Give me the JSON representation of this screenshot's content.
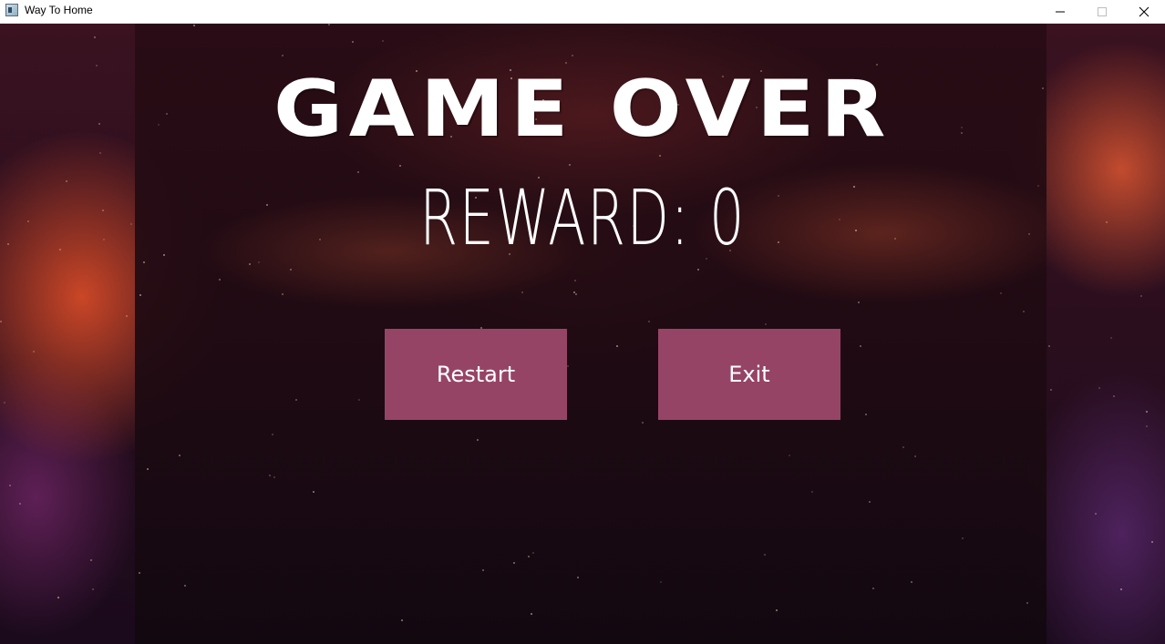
{
  "window": {
    "title": "Way To Home",
    "app_icon": "app-window-icon",
    "controls": [
      "minimize-icon",
      "maximize-icon",
      "close-icon"
    ]
  },
  "game": {
    "heading": "GAME OVER",
    "reward_label": "REWARD:",
    "reward_value": "0",
    "buttons": {
      "restart": "Restart",
      "exit": "Exit"
    }
  },
  "colors": {
    "button_fill": "#964466",
    "text": "#ffffff",
    "titlebar": "#ffffff"
  }
}
